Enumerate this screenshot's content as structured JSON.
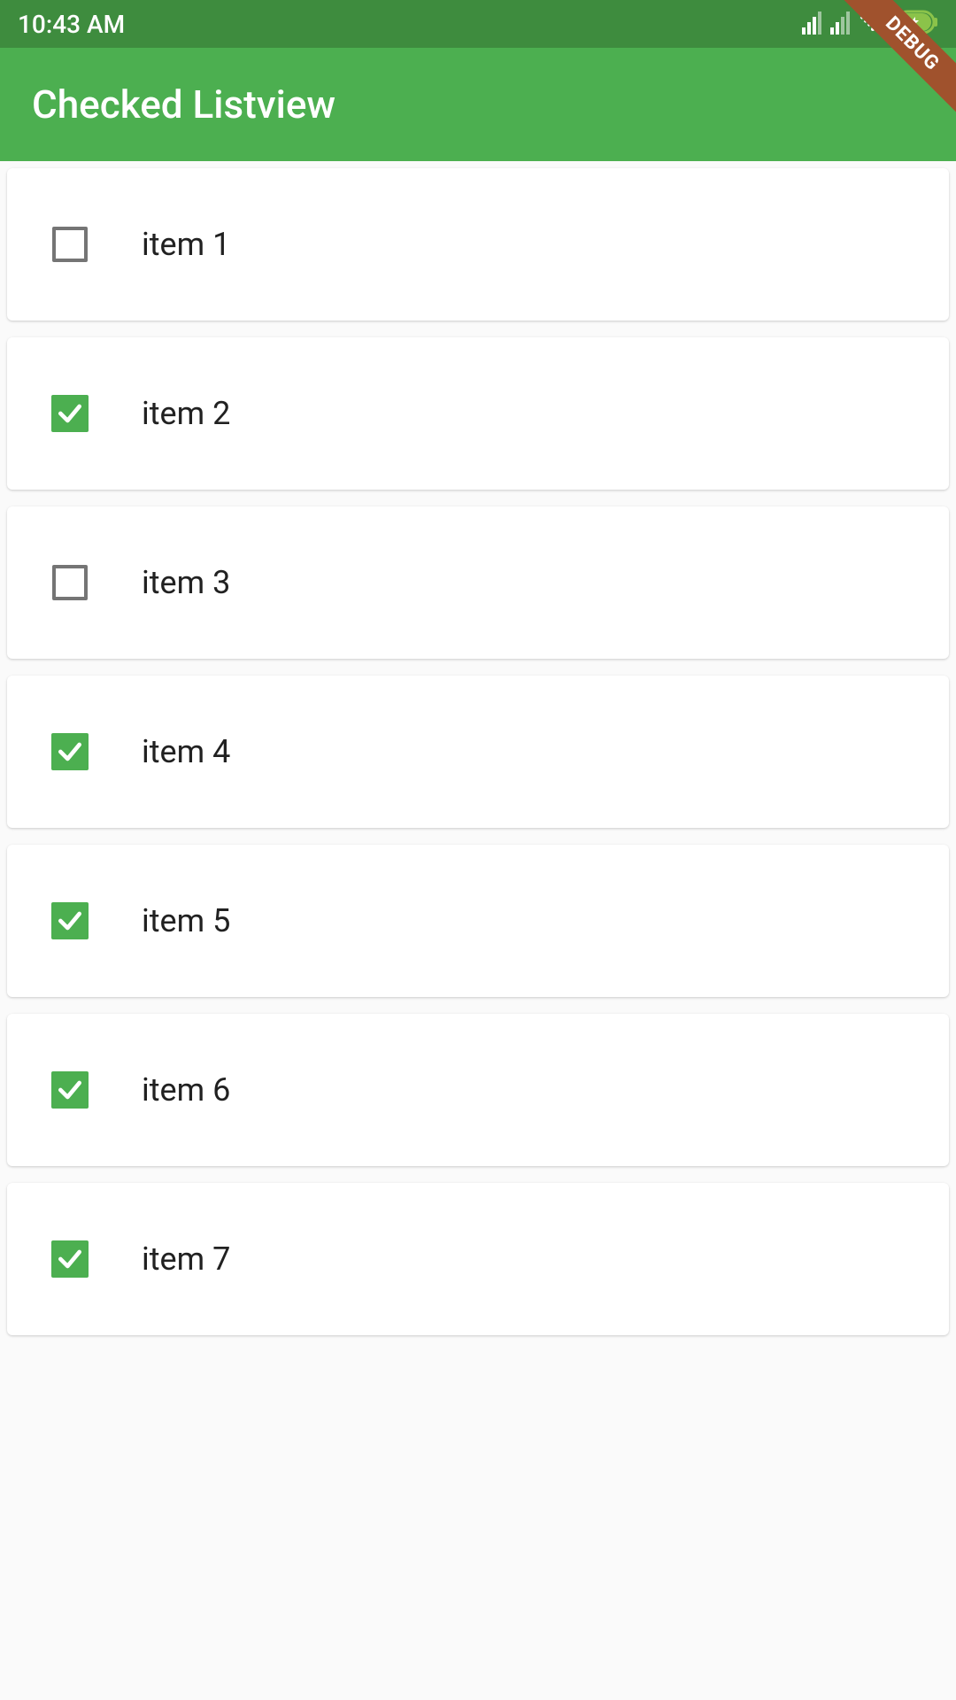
{
  "status_bar": {
    "time": "10:43 AM"
  },
  "app_bar": {
    "title": "Checked Listview"
  },
  "debug_banner": "DEBUG",
  "list_items": [
    {
      "label": "item 1",
      "checked": false
    },
    {
      "label": "item 2",
      "checked": true
    },
    {
      "label": "item 3",
      "checked": false
    },
    {
      "label": "item 4",
      "checked": true
    },
    {
      "label": "item 5",
      "checked": true
    },
    {
      "label": "item 6",
      "checked": true
    },
    {
      "label": "item 7",
      "checked": true
    }
  ],
  "colors": {
    "primary": "#4caf50",
    "status_bar": "#3e8c3e",
    "background": "#fafafa",
    "text": "#212121",
    "checkbox_border": "#757575"
  }
}
